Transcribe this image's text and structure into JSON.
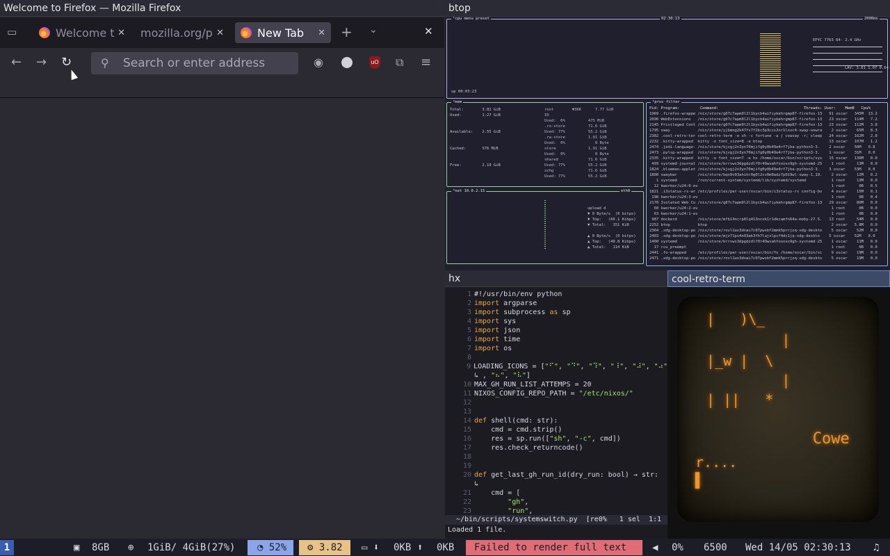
{
  "firefox": {
    "window_title": "Welcome to Firefox — Mozilla Firefox",
    "tabs": [
      {
        "label": "Welcome t"
      },
      {
        "label": "mozilla.org/p"
      },
      {
        "label": "New Tab"
      }
    ],
    "close_glyph": "✕",
    "new_tab_glyph": "+",
    "search_placeholder": "Search or enter address"
  },
  "btop": {
    "title": "btop",
    "cpu": {
      "uptime": "up 00:03:23",
      "model": "EPYC 7763 64-",
      "freq": "2.4 GHz",
      "time": "02:30:13",
      "rate": "2000ms",
      "load": "LAV: 3.81 1.07 0.64"
    },
    "mem": {
      "total": "3.82 GiB",
      "used": "1.27 GiB",
      "available": "2.55 GiB",
      "cached": "576 MiB",
      "free": "2.19 GiB"
    },
    "net": {
      "iface": "eth0",
      "addr": "10.0.2.15",
      "down_total": "151 KiB",
      "up_total": "114 KiB"
    },
    "proc_header": "Pid: Program:         Command:                                     Threads: User:    MemB   Cpu%",
    "proc_rows": [
      "1969 .firefox-wrappe /nix/store/g07c7apm0l2l1bycb4aifiykehrgmp87-firefox-13   91 oscar   345M  13.2",
      "2096 WebExtensions   /nix/store/g07c7apm0l2l1bycb4aifiykehrgmp87-firefox-13   23 oscar   114M   7.2",
      "2145 Privileged Cont /nix/store/g07c7apm0l2l1bycb4aifiykehrgmp87-firefox-13   23 oscar   112M   3.8",
      "1795 sway            /nix/store/yjbmng2k47fv7f2bc3p3ccs2nr1lxxc4-sway-unwra    2 oscar    65M   8.3",
      "2382 .cool-retro-ter cool-retro-term -e sh -c fortune -a | cowsay -r; sleep   24 oscar   162M   2.8",
      "2232 .kitty-wrapped  kitty -o font_size=8 -e btop                             13 oscar   107M   1.2",
      "2474 .jedi-language- /nix/store/kjvgj2n3yn70mjifg0y0b49e4rf7jba-python3-3.    2 oscar    50M   0.8",
      "2473 .pylsp-wrapped  /nix/store/kjvgj2n3yn70mjifg0y0b49e4rf7jba-python3-3.    1 oscar    31M   0.0",
      "2335 .kitty-wrapped  kitty -o font_size=7 -e hx /home/oscar/bin/scripts/sys   15 oscar   130M   0.0",
      " 499 systemd-journal /nix/store/brrvws3dpgdzdlf0r49wsahfoxosx9gh-systemd-25    1 root     13M   0.0",
      "1824 .blueman-applet /nix/store/kjvgj2n3yn70mjifg0y0b49e4rf7jba-python3-3.    3 oscar    53M   0.0",
      "1800 swaybar         /nix/store/bqn9v93ahihr0g0l2cv0m0adz7p019wl-sway-1.10.    2 oscar    12M   0.2",
      "   1 systemd         /run/current-system/systemd/lib/systemd/systemd           1 root     13M   0.0",
      "  12 kworker/u24:0-ev                                                          1 root      0B   0.5",
      "1821 .i3status-rs-wr /etc/profiles/per-user/oscar/bin/i3status-rs config-bo    4 oscar    15M   0.1",
      " 198 kworker/u24:3-ev                                                          1 root      0B   0.4",
      "2170 Isolated Web Co /nix/store/g07c7apm0l2l1bycb4aifiykehrgmp87-firefox-13   29 oscar    80M   0.0",
      "  60 kworker/u24:2-ev                                                          1 root      0B   0.0",
      "  63 kworker/u24:1-ev                                                          1 root      0B   0.0",
      " 987 dockerd         /nix/store/mfb14ncrp0lq413ncxk1r1dkcamfn64a-moby-27.5.   13 root     54M   0.0",
      "2252 btop            btop                                                      2 oscar   5.8M   0.0",
      "2364 .xdg-desktop-po /nix/store/rnvl1ax3dnai7c07pwsbf2mmk5prrjzq-xdg-deskto    5 oscar    52M   0.0",
      "2403 .xdg-desktop-po /nix/store/mjz71pv4n93ak3fh7lajslpcf4dc1jq-xdg-deskto    5 oscar    52M   0.0",
      "1400 systemd         /nix/store/brrvws3dpgdzdlf0r49wsahfoxosx9gh-systemd-25    1 oscar    11M   0.0",
      "  17 rcu_preempt                                                               1 root      0B   0.0",
      "2441 .fo-wrapped     /etc/profiles/per-user/oscar/bin/fo /home/oscar/bin/sc    9 oscar    19M   0.0",
      "2471 .xdg-desktop-po /nix/store/rnvl1ax3dnai7c07pwsbf2mmk5prrjzq-xdg-deskto    5 oscar    19M   0.0"
    ]
  },
  "hx": {
    "title": "hx",
    "lines": [
      {
        "n": "1",
        "t": "#!/usr/bin/env python"
      },
      {
        "n": "2",
        "t": "import argparse"
      },
      {
        "n": "3",
        "t": "import subprocess as sp"
      },
      {
        "n": "4",
        "t": "import sys"
      },
      {
        "n": "5",
        "t": "import json"
      },
      {
        "n": "6",
        "t": "import time"
      },
      {
        "n": "7",
        "t": "import os"
      },
      {
        "n": "8",
        "t": ""
      },
      {
        "n": "9",
        "t": "LOADING_ICONS = [\"⠋\", \"⠙\", \"⠹\", \"⠸\", \"⠼\", \"⠴\""
      },
      {
        "n": "",
        "t": "↳ , \"⠦\", \"⠧\"]"
      },
      {
        "n": "10",
        "t": "MAX_GH_RUN_LIST_ATTEMPS = 20"
      },
      {
        "n": "11",
        "t": "NIXOS_CONFIG_REPO_PATH = \"/etc/nixos/\""
      },
      {
        "n": "12",
        "t": ""
      },
      {
        "n": "13",
        "t": ""
      },
      {
        "n": "14",
        "t": "def shell(cmd: str):"
      },
      {
        "n": "15",
        "t": "    cmd = cmd.strip()"
      },
      {
        "n": "16",
        "t": "    res = sp.run([\"sh\", \"-c\", cmd])"
      },
      {
        "n": "17",
        "t": "    res.check_returncode()"
      },
      {
        "n": "18",
        "t": ""
      },
      {
        "n": "19",
        "t": ""
      },
      {
        "n": "20",
        "t": "def get_last_gh_run_id(dry_run: bool) → str:"
      },
      {
        "n": "",
        "t": "↳"
      },
      {
        "n": "21",
        "t": "    cmd = ["
      },
      {
        "n": "22",
        "t": "        \"gh\","
      },
      {
        "n": "23",
        "t": "        \"run\","
      }
    ],
    "status": "~/bin/scripts/systemswitch.py  [re0%   1 sel  1:1",
    "message": "Loaded 1 file."
  },
  "crt": {
    "title": "cool-retro-term",
    "lines": [
      "|   )\\_",
      "         |",
      "|_w |  \\",
      "         |",
      "| ||   *",
      "",
      "       Cowe",
      "r....",
      "▌"
    ]
  },
  "statusbar": {
    "workspace": "1",
    "disk": "8GB",
    "mem": "1GiB/ 4GiB(27%)",
    "cpu": "52%",
    "load": "3.82",
    "net_down": "0KB",
    "net_up": "0KB",
    "error": "Failed to render full text",
    "volume": "0%",
    "brightness": "6500",
    "clock": "Wed 14/05 02:30:13"
  }
}
